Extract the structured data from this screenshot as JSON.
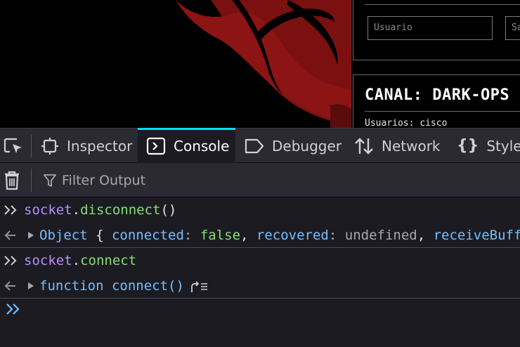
{
  "page": {
    "username_placeholder": "Usuario",
    "second_input_text": "Sa",
    "channel_title": "CANAL: DARK-OPS",
    "channel_users": "Usuarios: cisco"
  },
  "devtools": {
    "tabs": [
      {
        "label": "Inspector",
        "icon": "inspector-icon"
      },
      {
        "label": "Console",
        "icon": "console-icon",
        "selected": true
      },
      {
        "label": "Debugger",
        "icon": "debugger-icon"
      },
      {
        "label": "Network",
        "icon": "network-icon"
      },
      {
        "label": "Style Editor",
        "icon": "style-editor-icon"
      }
    ],
    "filter_placeholder": "Filter Output",
    "accent_color": "#00ddff"
  },
  "console": {
    "entries": [
      {
        "type": "input",
        "object": "socket",
        "dot": ".",
        "member": "disconnect",
        "call": "()"
      },
      {
        "type": "output",
        "parts": [
          "Object",
          " { ",
          "connected",
          ": ",
          "false",
          ", ",
          "recovered",
          ": ",
          "undefined",
          ", ",
          "receiveBuffer"
        ]
      },
      {
        "type": "input",
        "object": "socket",
        "dot": ".",
        "member": "connect",
        "call": ""
      },
      {
        "type": "output",
        "text": "function connect()"
      }
    ]
  }
}
